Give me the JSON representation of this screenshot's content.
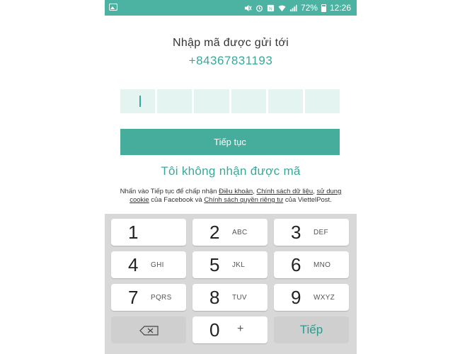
{
  "status_bar": {
    "battery": "72%",
    "time": "12:26",
    "icons": [
      "image-icon",
      "mute-icon",
      "alarm-icon",
      "nfc-icon",
      "wifi-icon",
      "signal-icon",
      "battery-icon"
    ]
  },
  "header": {
    "title": "Nhập mã được gửi tới",
    "phone_number": "+84367831193"
  },
  "code_input": {
    "box_count": 6,
    "values": [
      "",
      "",
      "",
      "",
      "",
      ""
    ]
  },
  "continue_button": {
    "label": "Tiếp tục"
  },
  "resend_link": {
    "label": "Tôi không nhận được mã"
  },
  "terms": {
    "part1": "Nhấn vào Tiếp tục để chấp nhận ",
    "link1": "Điều khoản",
    "sep1": ", ",
    "link2": "Chính sách dữ liệu",
    "sep2": ", ",
    "link3": "sử dụng cookie",
    "part2": " của Facebook và ",
    "link4": "Chính sách quyền riêng tư",
    "part3": " của ViettelPost."
  },
  "keyboard": {
    "keys": [
      {
        "digit": "1",
        "letters": ""
      },
      {
        "digit": "2",
        "letters": "ABC"
      },
      {
        "digit": "3",
        "letters": "DEF"
      },
      {
        "digit": "4",
        "letters": "GHI"
      },
      {
        "digit": "5",
        "letters": "JKL"
      },
      {
        "digit": "6",
        "letters": "MNO"
      },
      {
        "digit": "7",
        "letters": "PQRS"
      },
      {
        "digit": "8",
        "letters": "TUV"
      },
      {
        "digit": "9",
        "letters": "WXYZ"
      }
    ],
    "zero": {
      "digit": "0",
      "secondary": "+"
    },
    "next_label": "Tiếp"
  },
  "colors": {
    "accent": "#46ad9d",
    "status_bar": "#4cb2a2",
    "code_box": "#e4f5f1",
    "keyboard_bg": "#d8d8d8"
  }
}
